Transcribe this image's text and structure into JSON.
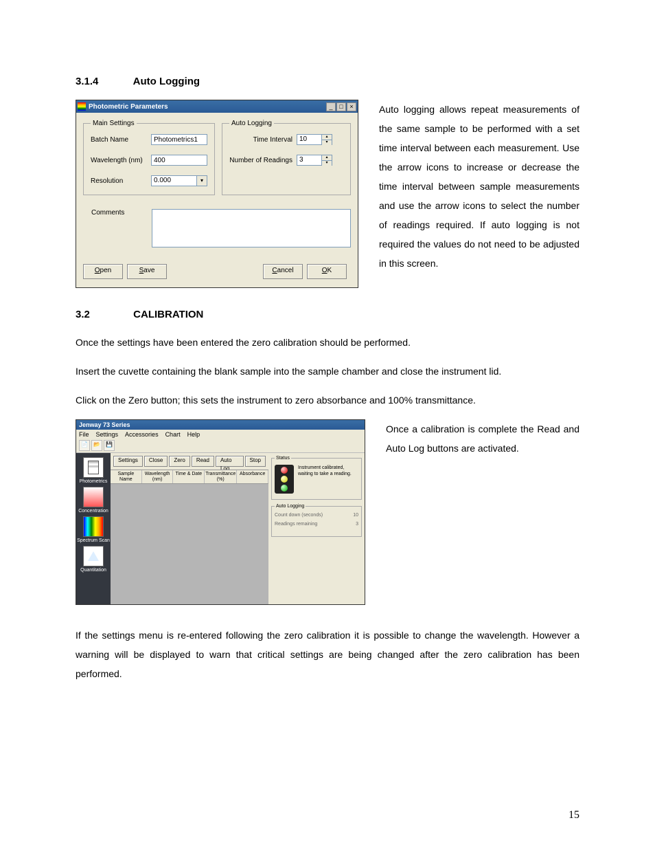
{
  "page_number": "15",
  "section1": {
    "num": "3.1.4",
    "title": "Auto Logging"
  },
  "dlg": {
    "title": "Photometric Parameters",
    "win_min": "_",
    "win_max": "□",
    "win_close": "×",
    "main_legend": "Main Settings",
    "batch_label": "Batch Name",
    "batch_value": "Photometrics1",
    "wave_label": "Wavelength (nm)",
    "wave_value": "400",
    "res_label": "Resolution",
    "res_value": "0.000",
    "dropdown_arrow": "▾",
    "auto_legend": "Auto Logging",
    "time_label": "Time Interval",
    "time_value": "10",
    "readings_label": "Number of Readings",
    "readings_value": "3",
    "spin_up": "▴",
    "spin_down": "▾",
    "comments_label": "Comments",
    "btn_open": "Open",
    "btn_open_u": "O",
    "btn_save": "Save",
    "btn_save_u": "S",
    "btn_cancel": "Cancel",
    "btn_cancel_u": "C",
    "btn_ok": "OK",
    "btn_ok_u": "O"
  },
  "para1": "Auto logging allows repeat measurements of the same sample to be performed with a set time interval between each measurement. Use the arrow icons to increase or decrease the time interval between sample measurements and use the arrow icons to select the number of readings required. If auto logging is not required the values do not need to be adjusted in this screen.",
  "section2": {
    "num": "3.2",
    "title": "CALIBRATION"
  },
  "para2a": "Once the settings have been entered the zero calibration should be performed.",
  "para2b": "Insert the cuvette containing the blank sample into the sample chamber and close the instrument lid.",
  "para2c": "Click on the Zero button; this sets the instrument to zero absorbance and 100% transmittance.",
  "app": {
    "title": "Jenway 73 Series",
    "menu": {
      "file": "File",
      "settings": "Settings",
      "accessories": "Accessories",
      "chart": "Chart",
      "help": "Help"
    },
    "tool": {
      "new": "📄",
      "open": "📂",
      "save": "💾"
    },
    "sidebar": {
      "photometrics": "Photometrics",
      "concentration": "Concentration",
      "spectrum": "Spectrum Scan",
      "quantitation": "Quantitation"
    },
    "actions": {
      "settings": "Settings",
      "close": "Close",
      "zero": "Zero",
      "read": "Read",
      "autolog": "Auto Log",
      "stop": "Stop"
    },
    "cols": {
      "sample": "Sample Name",
      "wave": "Wavelength (nm)",
      "time": "Time & Date",
      "trans": "Transmittance (%)",
      "abs": "Absorbance"
    },
    "status": {
      "legend": "Status",
      "msg": "Instrument calibrated, waiting to take a reading."
    },
    "autolog_panel": {
      "legend": "Auto Logging",
      "countdown_label": "Count down (seconds)",
      "countdown_value": "10",
      "remaining_label": "Readings remaining",
      "remaining_value": "3"
    }
  },
  "para3": "Once a calibration is complete the Read and Auto Log buttons are activated.",
  "para4": "If the settings menu is re-entered following the zero calibration it is possible to change the wavelength. However a warning will be displayed to warn that critical settings are being changed after the zero calibration has been performed."
}
